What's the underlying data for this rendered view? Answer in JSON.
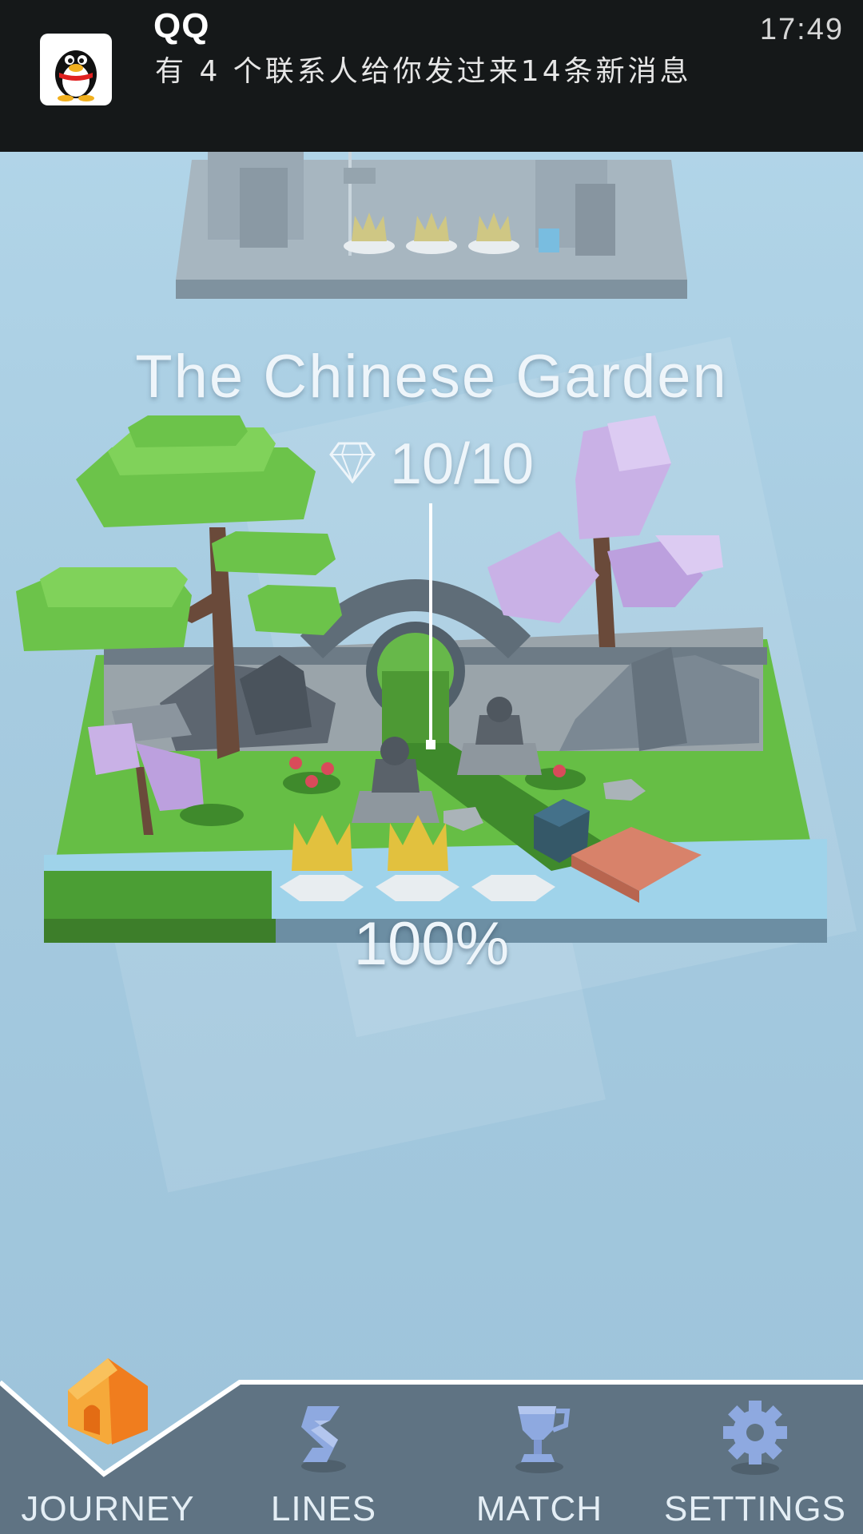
{
  "notification": {
    "app_name": "QQ",
    "message": "有 4 个联系人给你发过来14条新消息",
    "time": "17:49",
    "icon": "qq-penguin-icon"
  },
  "level": {
    "title": "The Chinese Garden",
    "gems": "10/10",
    "gem_icon": "diamond-icon",
    "progress_text": "100%",
    "crowns_earned": 2,
    "crowns_total": 3
  },
  "nav": {
    "items": [
      {
        "label": "JOURNEY",
        "icon": "home-icon",
        "active": true
      },
      {
        "label": "LINES",
        "icon": "lines-icon",
        "active": false
      },
      {
        "label": "MATCH",
        "icon": "trophy-icon",
        "active": false
      },
      {
        "label": "SETTINGS",
        "icon": "gear-icon",
        "active": false
      }
    ]
  },
  "colors": {
    "background": "#a9cde2",
    "nav_bar": "#5f7383",
    "accent_home": "#f59a23",
    "crown_gold": "#e2c13e",
    "grass": "#6cc34a",
    "blossom": "#c9b1e6"
  }
}
